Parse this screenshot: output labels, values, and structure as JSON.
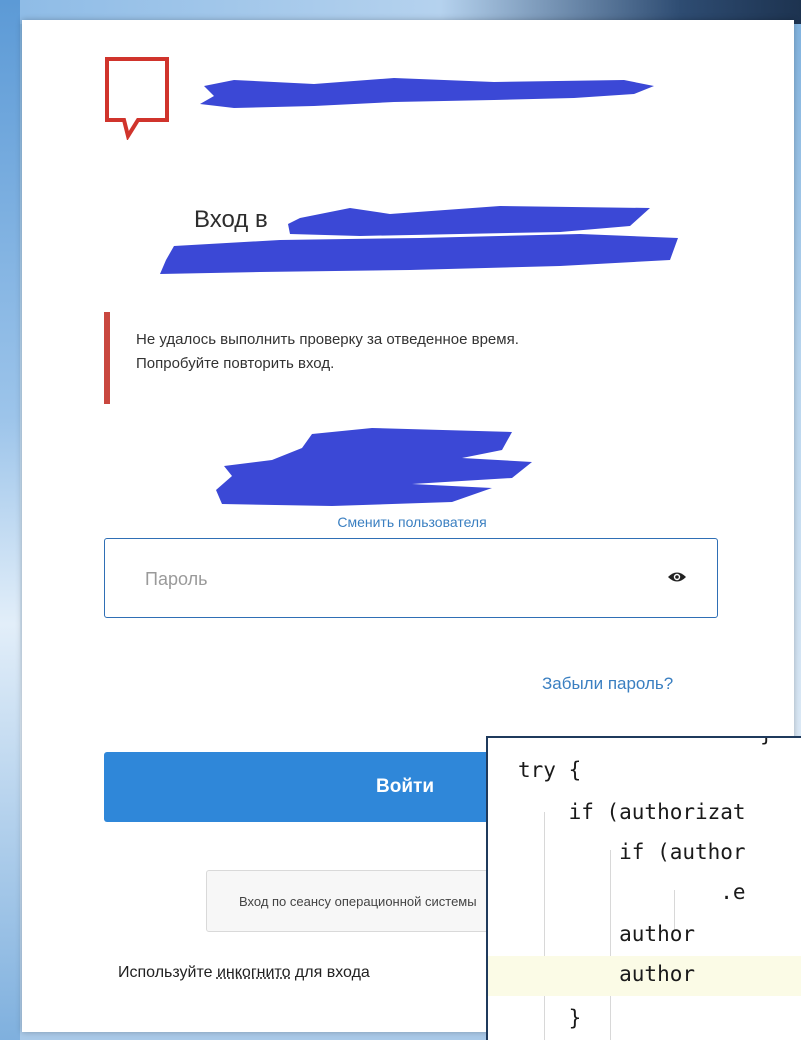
{
  "title_prefix": "Вход в",
  "alert": {
    "line1": "Не удалось выполнить проверку за отведенное время.",
    "line2": "Попробуйте повторить вход."
  },
  "switch_user_label": "Сменить пользователя",
  "password": {
    "placeholder": "Пароль",
    "value": ""
  },
  "forgot_password_label": "Забыли пароль?",
  "login_button_label": "Войти",
  "session_button_label": "Вход по сеансу операционной системы",
  "incognito": {
    "before": "Используйте ",
    "link": "инкогнито",
    "after": " для входа"
  },
  "code": {
    "top_fragment": "}",
    "lines": [
      "try {",
      "    if (authorizat",
      "        if (author",
      "                .e",
      "        author",
      "        author",
      "    }"
    ]
  },
  "colors": {
    "accent": "#2f87d9",
    "link": "#3a7fc1",
    "alert_bar": "#c9473f",
    "logo": "#d0342c",
    "redaction": "#3b48d6"
  },
  "icons": {
    "logo": "speech-bubble-logo-icon",
    "password_toggle": "eye-icon"
  }
}
